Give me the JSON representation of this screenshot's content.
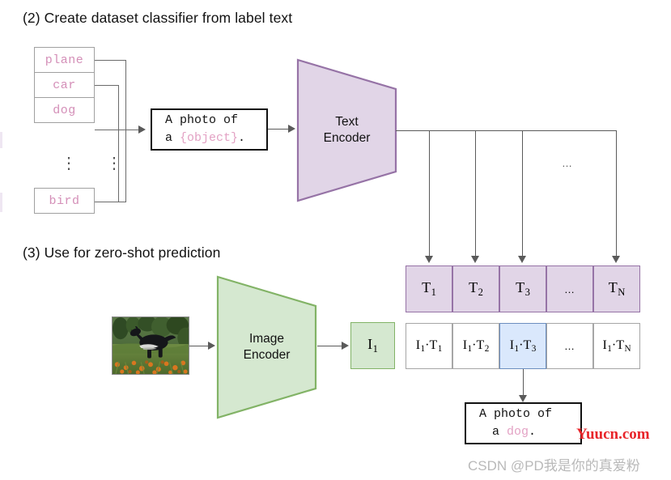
{
  "headings": {
    "step2": "(2) Create dataset classifier from label text",
    "step3": "(3) Use for zero-shot prediction"
  },
  "labels": {
    "items": [
      "plane",
      "car",
      "dog",
      "bird"
    ],
    "ellipsis": "⋮"
  },
  "prompt_template": {
    "line1": "A photo of",
    "line2_prefix": "a ",
    "line2_slot": "{object}",
    "line2_suffix": "."
  },
  "prompt_result": {
    "line1": "A photo of",
    "line2_prefix": "a ",
    "line2_slot": "dog",
    "line2_suffix": "."
  },
  "encoders": {
    "text": {
      "line1": "Text",
      "line2": "Encoder",
      "fill": "#e1d5e7",
      "stroke": "#9673a6"
    },
    "image": {
      "line1": "Image",
      "line2": "Encoder",
      "fill": "#d5e8d0",
      "stroke": "#82b366"
    }
  },
  "text_embeddings": {
    "cells": [
      {
        "base": "T",
        "sub": "1"
      },
      {
        "base": "T",
        "sub": "2"
      },
      {
        "base": "T",
        "sub": "3"
      },
      {
        "base": "…",
        "sub": ""
      },
      {
        "base": "T",
        "sub": "N"
      }
    ],
    "fill": "#e1d5e7",
    "stroke": "#9673a6"
  },
  "image_embedding": {
    "base": "I",
    "sub": "1",
    "fill": "#d5e8d0",
    "stroke": "#82b366"
  },
  "similarity_row": {
    "cells": [
      {
        "left_base": "I",
        "left_sub": "1",
        "op": "·",
        "right_base": "T",
        "right_sub": "1",
        "highlighted": false
      },
      {
        "left_base": "I",
        "left_sub": "1",
        "op": "·",
        "right_base": "T",
        "right_sub": "2",
        "highlighted": false
      },
      {
        "left_base": "I",
        "left_sub": "1",
        "op": "·",
        "right_base": "T",
        "right_sub": "3",
        "highlighted": true
      },
      {
        "left_base": "…",
        "left_sub": "",
        "op": "",
        "right_base": "",
        "right_sub": "",
        "highlighted": false
      },
      {
        "left_base": "I",
        "left_sub": "1",
        "op": "·",
        "right_base": "T",
        "right_sub": "N",
        "highlighted": false
      }
    ],
    "highlight_fill": "#dae8fc",
    "highlight_stroke": "#6c8ebf"
  },
  "fanout_ellipsis": "…",
  "watermarks": {
    "red": "Yuucn.com",
    "csdn": "CSDN @PD我是你的真爱粉"
  },
  "colors": {
    "purple_fill": "#e1d5e7",
    "purple_stroke": "#9673a6",
    "green_fill": "#d5e8d0",
    "green_stroke": "#82b366",
    "blue_fill": "#dae8fc",
    "blue_stroke": "#6c8ebf",
    "label_text": "#d48fb8",
    "connector": "#5a5a5a",
    "watermark_red": "#e8252a"
  }
}
